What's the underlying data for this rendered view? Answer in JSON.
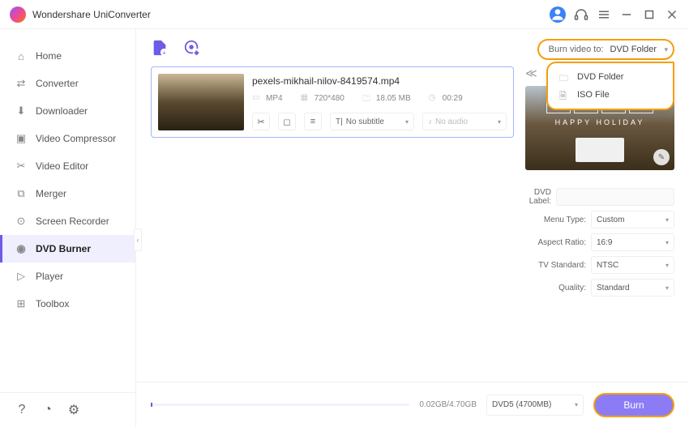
{
  "app": {
    "title": "Wondershare UniConverter"
  },
  "titlebar": {
    "avatar_initial": ""
  },
  "sidebar": {
    "items": [
      {
        "label": "Home",
        "icon": "home-icon"
      },
      {
        "label": "Converter",
        "icon": "convert-icon"
      },
      {
        "label": "Downloader",
        "icon": "download-icon"
      },
      {
        "label": "Video Compressor",
        "icon": "compress-icon"
      },
      {
        "label": "Video Editor",
        "icon": "editor-icon"
      },
      {
        "label": "Merger",
        "icon": "merger-icon"
      },
      {
        "label": "Screen Recorder",
        "icon": "recorder-icon"
      },
      {
        "label": "DVD Burner",
        "icon": "dvd-icon",
        "active": true
      },
      {
        "label": "Player",
        "icon": "player-icon"
      },
      {
        "label": "Toolbox",
        "icon": "toolbox-icon"
      }
    ]
  },
  "burn_to": {
    "label": "Burn video to:",
    "selected": "DVD Folder",
    "options": [
      {
        "label": "DVD Folder"
      },
      {
        "label": "ISO File"
      }
    ]
  },
  "file": {
    "name": "pexels-mikhail-nilov-8419574.mp4",
    "format": "MP4",
    "resolution": "720*480",
    "size": "18.05 MB",
    "duration": "00:29",
    "subtitle": "No subtitle",
    "audio": "No audio"
  },
  "preview": {
    "banner": "HAPPY HOLIDAY"
  },
  "settings": {
    "dvd_label_label": "DVD Label:",
    "dvd_label_value": "",
    "menu_type_label": "Menu Type:",
    "menu_type_value": "Custom",
    "aspect_ratio_label": "Aspect Ratio:",
    "aspect_ratio_value": "16:9",
    "tv_standard_label": "TV Standard:",
    "tv_standard_value": "NTSC",
    "quality_label": "Quality:",
    "quality_value": "Standard"
  },
  "bottom": {
    "size_text": "0.02GB/4.70GB",
    "disc": "DVD5 (4700MB)",
    "burn_label": "Burn"
  }
}
